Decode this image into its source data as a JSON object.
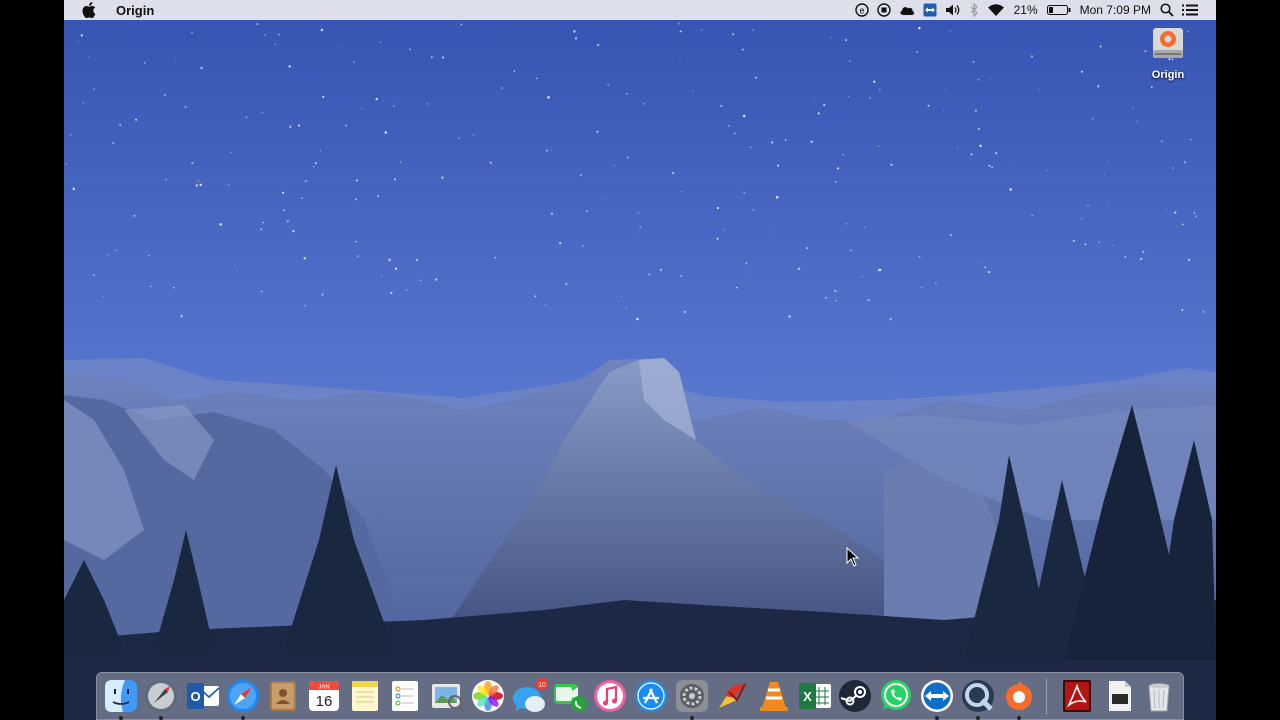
{
  "menubar": {
    "app_name": "Origin",
    "battery_percent": "21%",
    "clock": "Mon 7:09 PM",
    "icons": [
      "apple-icon",
      "evernote-icon",
      "screen-record-icon",
      "onedrive-icon",
      "teamviewer-icon",
      "volume-icon",
      "bluetooth-icon",
      "wifi-icon",
      "battery-icon",
      "spotlight-icon",
      "notification-center-icon"
    ]
  },
  "desktop": {
    "icon_label": "Origin",
    "icon": "origin-drive-icon"
  },
  "dock": {
    "calendar_month": "JAN",
    "calendar_day": "16",
    "messages_badge": "10",
    "outlook_letter": "O",
    "excel_letter": "X",
    "apps": [
      "Finder",
      "Launchpad",
      "Microsoft Outlook",
      "Safari",
      "Contacts",
      "Calendar",
      "Notes",
      "Reminders",
      "Preview",
      "Photos",
      "Messages",
      "FaceTime",
      "iTunes",
      "App Store",
      "System Preferences",
      "CCleaner",
      "VLC",
      "Microsoft Excel",
      "Steam",
      "WhatsApp",
      "TeamViewer",
      "QuickTime Player",
      "Origin",
      "Adobe Acrobat",
      "Document",
      "Trash"
    ]
  },
  "colors": {
    "sky_top": "#3c5ab8",
    "sky_bottom": "#6a86d6",
    "menubar_bg": "#ececf0",
    "dock_bg": "#d7dceb"
  }
}
